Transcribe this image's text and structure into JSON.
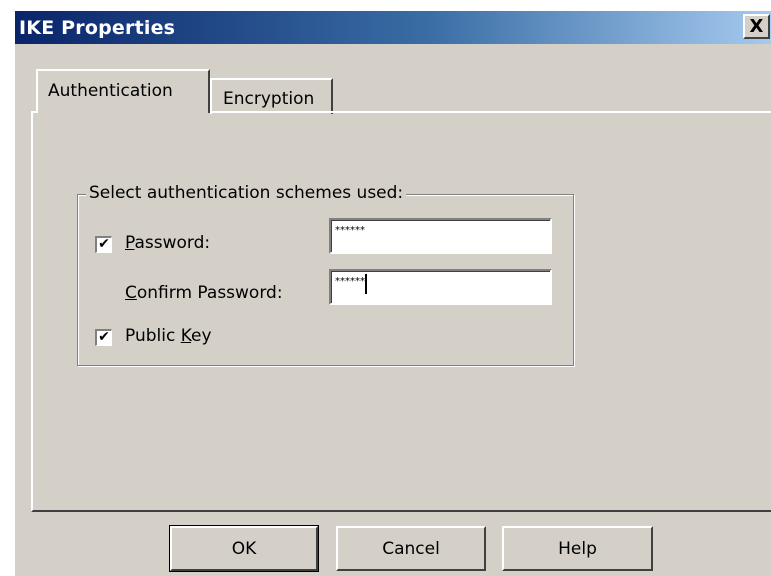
{
  "window": {
    "title": "IKE Properties",
    "close_glyph": "X"
  },
  "tabs": [
    {
      "label": "Authentication",
      "selected": true
    },
    {
      "label": "Encryption",
      "selected": false
    }
  ],
  "group": {
    "legend": "Select authentication schemes used:"
  },
  "password": {
    "checked": true,
    "label_mnemonic": "P",
    "label_rest": "assword:",
    "value": "******"
  },
  "confirm_password": {
    "label_mnemonic": "C",
    "label_rest": "onfirm Password:",
    "value": "******"
  },
  "public_key": {
    "checked": true,
    "label_pre": "Public ",
    "label_mnemonic": "K",
    "label_rest": "ey"
  },
  "check_glyph": "✔",
  "buttons": {
    "ok": "OK",
    "cancel": "Cancel",
    "help": "Help"
  }
}
